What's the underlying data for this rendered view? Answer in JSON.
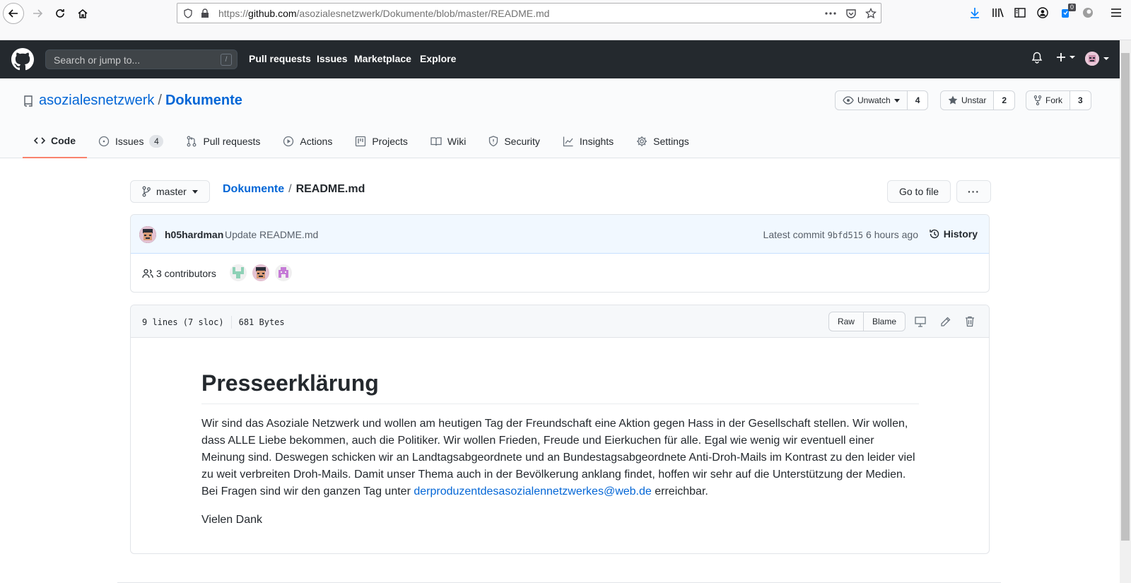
{
  "browser": {
    "url_prefix": "https://",
    "url_host": "github.com",
    "url_path": "/asozialesnetzwerk/Dokumente/blob/master/README.md",
    "downloads_badge": "0"
  },
  "gh_header": {
    "search_placeholder": "Search or jump to...",
    "search_key": "/",
    "nav": [
      "Pull requests",
      "Issues",
      "Marketplace",
      "Explore"
    ]
  },
  "repo": {
    "owner": "asozialesnetzwerk",
    "separator": "/",
    "name": "Dokumente",
    "watch_label": "Unwatch",
    "watch_count": "4",
    "star_label": "Unstar",
    "star_count": "2",
    "fork_label": "Fork",
    "fork_count": "3"
  },
  "tabs": [
    {
      "label": "Code",
      "icon": "code-icon"
    },
    {
      "label": "Issues",
      "icon": "issue-icon",
      "count": "4"
    },
    {
      "label": "Pull requests",
      "icon": "pull-request-icon"
    },
    {
      "label": "Actions",
      "icon": "play-icon"
    },
    {
      "label": "Projects",
      "icon": "project-icon"
    },
    {
      "label": "Wiki",
      "icon": "book-icon"
    },
    {
      "label": "Security",
      "icon": "shield-icon"
    },
    {
      "label": "Insights",
      "icon": "graph-icon"
    },
    {
      "label": "Settings",
      "icon": "gear-icon"
    }
  ],
  "file_nav": {
    "branch": "master",
    "crumb_repo": "Dokumente",
    "crumb_sep": "/",
    "crumb_file": "README.md",
    "go_to_file": "Go to file",
    "more": "···"
  },
  "commit": {
    "author": "h05hardman",
    "message": "Update README.md",
    "latest_label": "Latest commit",
    "sha": "9bfd515",
    "time": "6 hours ago",
    "history": "History",
    "contributors": "3 contributors"
  },
  "file": {
    "lines": "9 lines (7 sloc)",
    "size": "681 Bytes",
    "raw": "Raw",
    "blame": "Blame"
  },
  "readme": {
    "title": "Presseerklärung",
    "para_before_link": "Wir sind das Asoziale Netzwerk und wollen am heutigen Tag der Freundschaft eine Aktion gegen Hass in der Gesellschaft stellen. Wir wollen, dass ALLE Liebe bekommen, auch die Politiker. Wir wollen Frieden, Freude und Eierkuchen für alle. Egal wie wenig wir eventuell einer Meinung sind. Deswegen schicken wir an Landtagsabgeordnete und an Bundestagsabgeordnete Anti-Droh-Mails im Kontrast zu den leider viel zu weit verbreiten Droh-Mails. Damit unser Thema auch in der Bevölkerung anklang findet, hoffen wir sehr auf die Unterstützung der Medien. Bei Fragen sind wir den ganzen Tag unter ",
    "email": "derproduzentdesasozialennetzwerkes@web.de",
    "para_after_link": " erreichbar.",
    "closing": "Vielen Dank"
  },
  "colors": {
    "header_bg": "#24292e",
    "link": "#0366d6",
    "tab_underline": "#f9826c",
    "commit_bg": "#f1f8ff"
  }
}
